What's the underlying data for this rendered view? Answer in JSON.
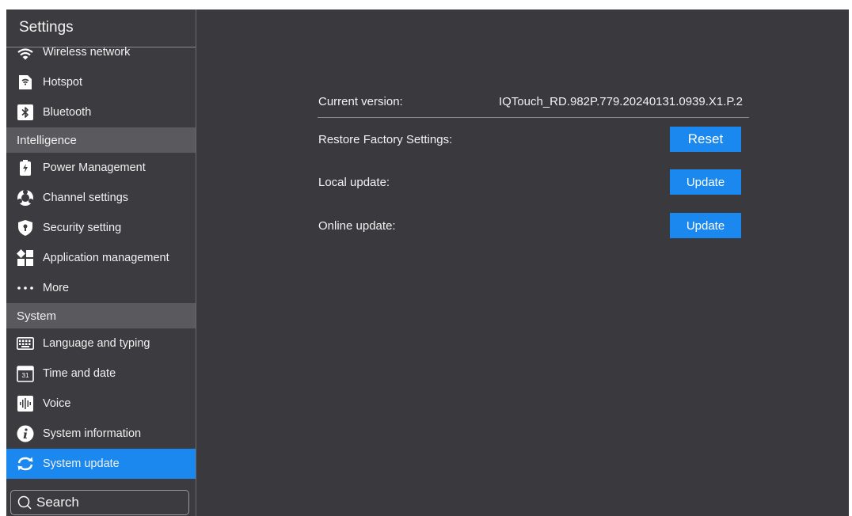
{
  "sidebar": {
    "title": "Settings",
    "items_top": [
      {
        "label": "Wireless network",
        "icon": "wifi-icon"
      },
      {
        "label": "Hotspot",
        "icon": "hotspot-icon"
      },
      {
        "label": "Bluetooth",
        "icon": "bluetooth-icon"
      }
    ],
    "section_intelligence": "Intelligence",
    "items_intelligence": [
      {
        "label": "Power Management",
        "icon": "battery-icon"
      },
      {
        "label": "Channel settings",
        "icon": "channel-icon"
      },
      {
        "label": "Security setting",
        "icon": "shield-icon"
      },
      {
        "label": "Application management",
        "icon": "apps-icon"
      },
      {
        "label": "More",
        "icon": "more-icon"
      }
    ],
    "section_system": "System",
    "items_system": [
      {
        "label": "Language and typing",
        "icon": "keyboard-icon"
      },
      {
        "label": "Time and date",
        "icon": "calendar-icon"
      },
      {
        "label": "Voice",
        "icon": "voice-icon"
      },
      {
        "label": "System information",
        "icon": "info-icon"
      },
      {
        "label": "System update",
        "icon": "sync-icon",
        "active": true
      }
    ],
    "calendar_day": "31",
    "search_label": "Search"
  },
  "main": {
    "current_version_label": "Current version:",
    "current_version_value": "IQTouch_RD.982P.779.20240131.0939.X1.P.2",
    "restore_label": "Restore Factory Settings:",
    "reset_button": "Reset",
    "local_update_label": "Local update:",
    "local_update_button": "Update",
    "online_update_label": "Online update:",
    "online_update_button": "Update"
  },
  "colors": {
    "accent": "#1a88ee",
    "background": "#3a3a3e",
    "section_header": "#5a5a5e"
  }
}
